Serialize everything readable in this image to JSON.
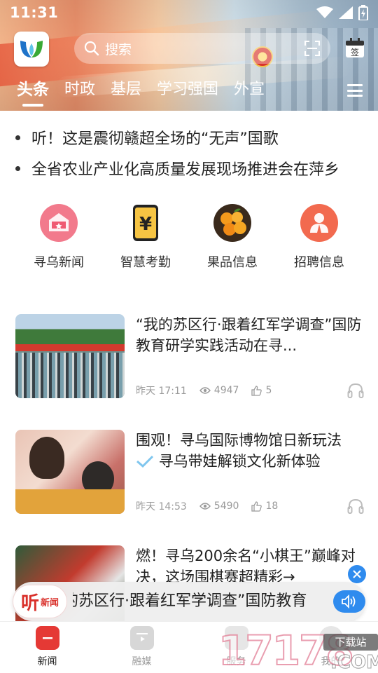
{
  "status_bar": {
    "time": "11:31"
  },
  "header": {
    "search_placeholder": "搜索",
    "tabs": [
      {
        "label": "头条",
        "active": true
      },
      {
        "label": "时政",
        "active": false
      },
      {
        "label": "基层",
        "active": false
      },
      {
        "label": "学习强国",
        "active": false
      },
      {
        "label": "外宣",
        "active": false
      }
    ]
  },
  "headlines": [
    "听！这是震彻赣超全场的“无声”国歌",
    "全省农业产业化高质量发展现场推进会在萍乡"
  ],
  "shortcuts": [
    {
      "label": "寻乌新闻",
      "icon": "newspaper-icon"
    },
    {
      "label": "智慧考勤",
      "icon": "attendance-icon"
    },
    {
      "label": "果品信息",
      "icon": "fruit-icon"
    },
    {
      "label": "招聘信息",
      "icon": "recruit-icon"
    }
  ],
  "news": [
    {
      "title": "“我的苏区行·跟着红军学调查”国防教育研学实践活动在寻...",
      "time": "昨天 17:11",
      "views": "4947",
      "likes": "5"
    },
    {
      "title_part1": "围观！寻乌国际博物馆日新玩法",
      "title_part2": "寻乌带娃解锁文化新体验",
      "time": "昨天 14:53",
      "views": "5490",
      "likes": "18"
    },
    {
      "title": "燃！寻乌200余名“小棋王”巅峰对决，这场围棋赛超精彩→"
    }
  ],
  "audio_bar": {
    "badge_big": "听",
    "badge_small": "新闻",
    "text": "的苏区行·跟着红军学调查”国防教育"
  },
  "bottom_nav": [
    {
      "label": "新闻",
      "active": true
    },
    {
      "label": "融媒",
      "active": false
    },
    {
      "label": "服务",
      "active": false
    },
    {
      "label": "我的",
      "active": false
    }
  ],
  "watermark": {
    "digits": "17178",
    "download": "下载站",
    "domain": ".COM"
  },
  "colors": {
    "accent_red": "#e53935",
    "accent_blue": "#2f8bee",
    "muted_text": "#9a9a9a"
  }
}
